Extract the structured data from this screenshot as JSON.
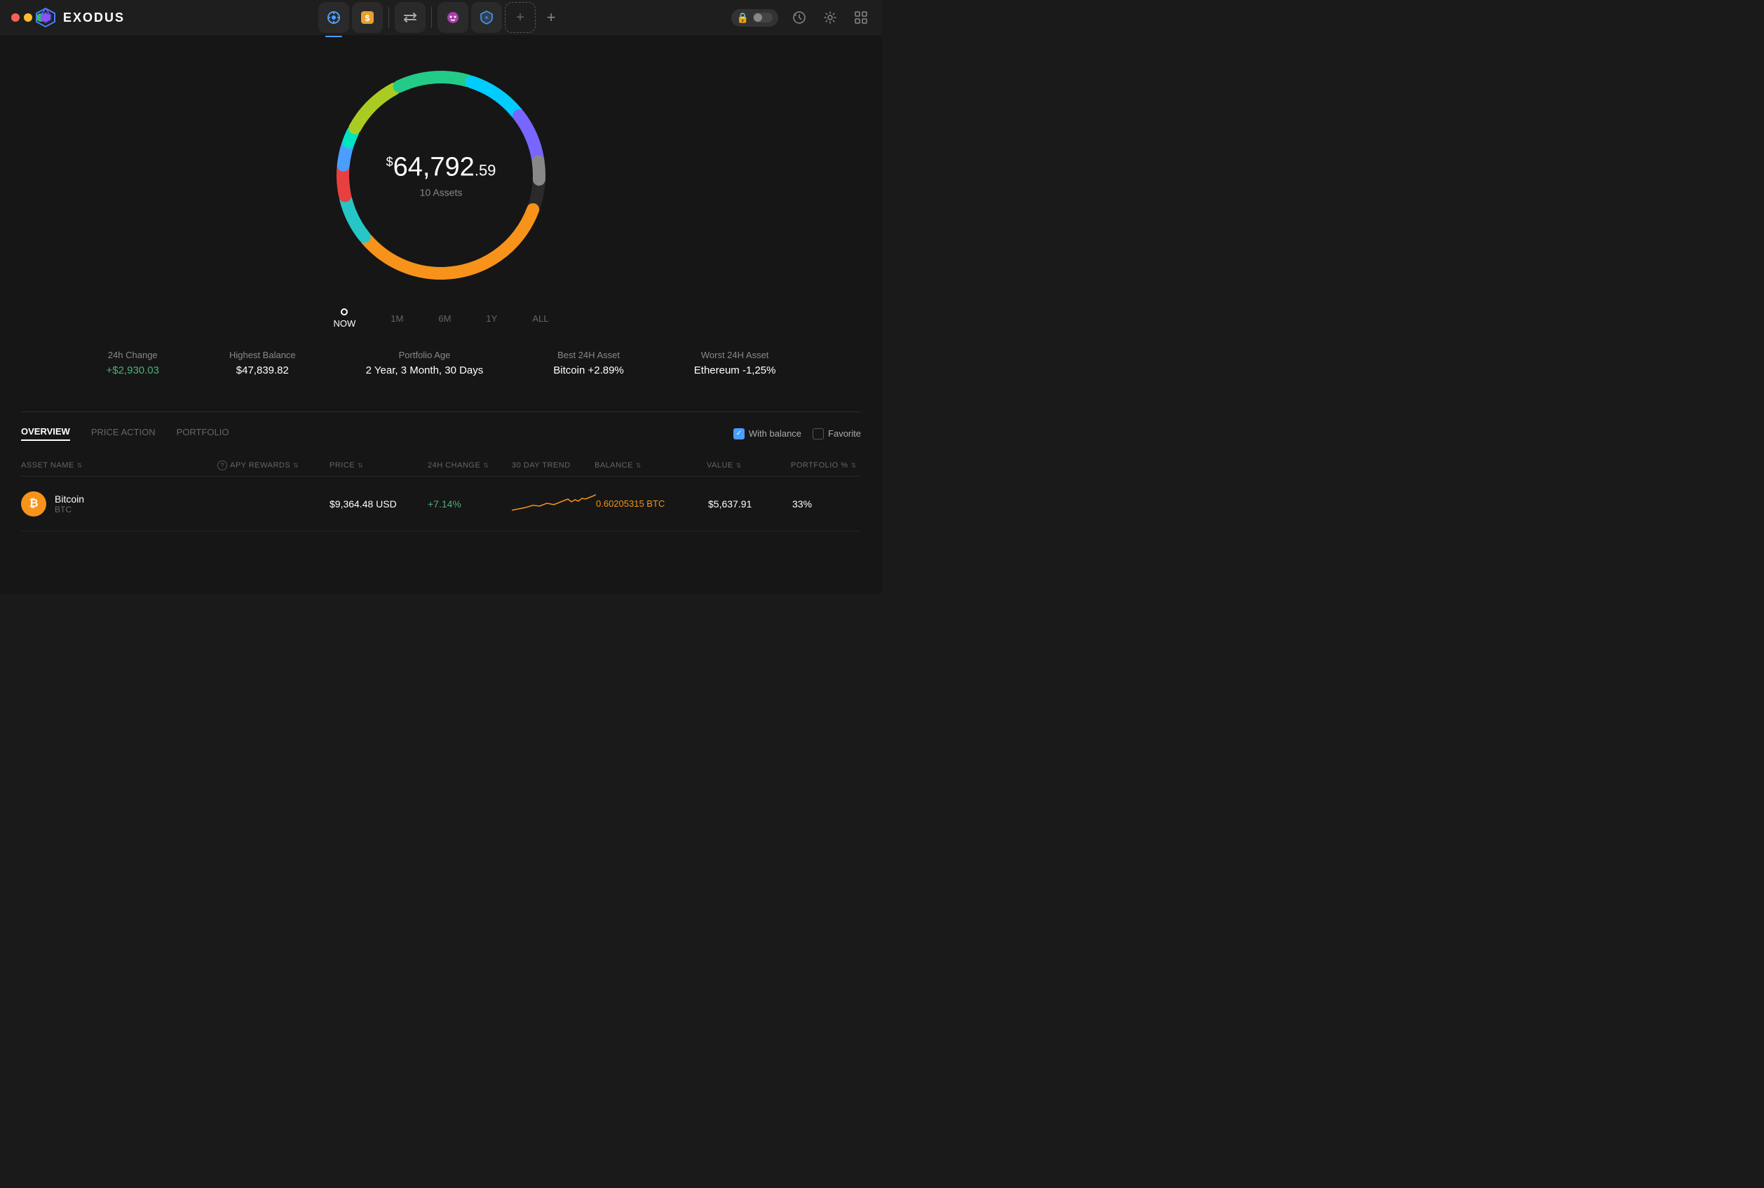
{
  "titlebar": {
    "traffic_lights": [
      "red",
      "yellow",
      "green"
    ],
    "logo_text": "EXODUS"
  },
  "nav": {
    "tabs": [
      {
        "id": "portfolio",
        "label": "Portfolio",
        "active": true,
        "icon": "◎"
      },
      {
        "id": "exchange",
        "label": "Exchange",
        "icon": "🟧"
      },
      {
        "id": "transfer",
        "label": "Transfer",
        "icon": "⇌"
      },
      {
        "id": "companion",
        "label": "Companion",
        "icon": "👾"
      },
      {
        "id": "protect",
        "label": "Protect",
        "icon": "🛡"
      },
      {
        "id": "add",
        "label": "+"
      }
    ],
    "right_icons": [
      "lock",
      "history",
      "settings",
      "grid"
    ]
  },
  "portfolio": {
    "amount_prefix": "$",
    "amount_main": "64,792",
    "amount_cents": ".59",
    "assets_count": "10 Assets",
    "timeline": [
      "NOW",
      "1M",
      "6M",
      "1Y",
      "ALL"
    ]
  },
  "stats": [
    {
      "label": "24h Change",
      "value": "+$2,930.03",
      "positive": true
    },
    {
      "label": "Highest Balance",
      "value": "$47,839.82",
      "positive": false
    },
    {
      "label": "Portfolio Age",
      "value": "2 Year, 3 Month, 30 Days",
      "positive": false
    },
    {
      "label": "Best 24H Asset",
      "value": "Bitcoin +2.89%",
      "positive": false
    },
    {
      "label": "Worst 24H Asset",
      "value": "Ethereum -1,25%",
      "positive": false
    }
  ],
  "table": {
    "tabs": [
      {
        "label": "OVERVIEW",
        "active": true
      },
      {
        "label": "PRICE ACTION",
        "active": false
      },
      {
        "label": "PORTFOLIO",
        "active": false
      }
    ],
    "filters": [
      {
        "label": "With balance",
        "checked": true
      },
      {
        "label": "Favorite",
        "checked": false
      }
    ],
    "columns": [
      {
        "label": "ASSET NAME",
        "sortable": true
      },
      {
        "label": "APY REWARDS",
        "sortable": true,
        "help": true
      },
      {
        "label": "PRICE",
        "sortable": true
      },
      {
        "label": "24H CHANGE",
        "sortable": true
      },
      {
        "label": "30 DAY TREND",
        "sortable": false
      },
      {
        "label": "BALANCE",
        "sortable": true
      },
      {
        "label": "VALUE",
        "sortable": true
      },
      {
        "label": "PORTFOLIO %",
        "sortable": true
      }
    ],
    "rows": [
      {
        "name": "Bitcoin",
        "ticker": "BTC",
        "icon_color": "#f7931a",
        "icon_letter": "₿",
        "apy": "",
        "price": "$9,364.48 USD",
        "change_24h": "+7.14%",
        "change_positive": true,
        "balance": "0.60205315 BTC",
        "value": "$5,637.91",
        "portfolio_pct": "33%"
      }
    ]
  }
}
